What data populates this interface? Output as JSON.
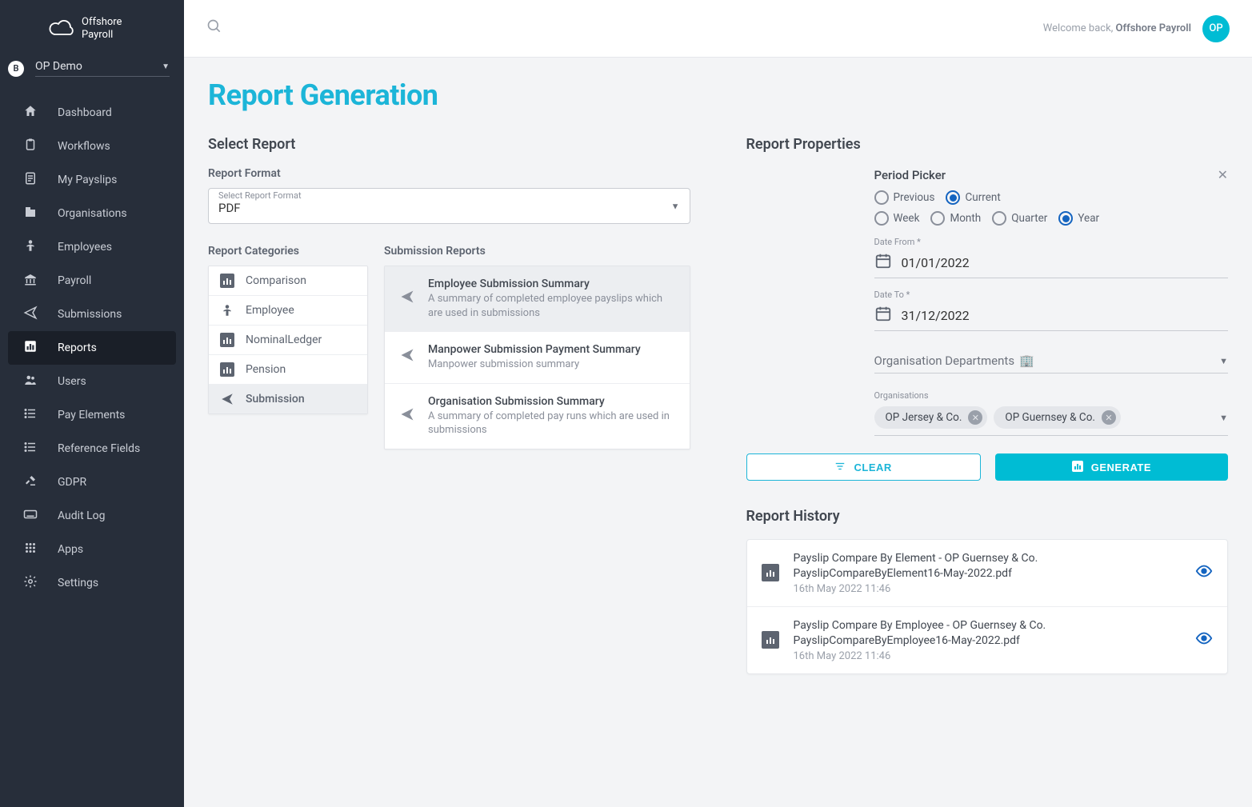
{
  "app": {
    "name1": "Offshore",
    "name2": "Payroll"
  },
  "org": {
    "bullet": "B",
    "name": "OP Demo"
  },
  "nav": [
    {
      "icon": "home",
      "label": "Dashboard"
    },
    {
      "icon": "clipboard",
      "label": "Workflows"
    },
    {
      "icon": "doc",
      "label": "My Payslips"
    },
    {
      "icon": "building",
      "label": "Organisations"
    },
    {
      "icon": "person",
      "label": "Employees"
    },
    {
      "icon": "bank",
      "label": "Payroll"
    },
    {
      "icon": "send",
      "label": "Submissions"
    },
    {
      "icon": "chart",
      "label": "Reports",
      "active": true
    },
    {
      "icon": "users",
      "label": "Users"
    },
    {
      "icon": "list",
      "label": "Pay Elements"
    },
    {
      "icon": "list",
      "label": "Reference Fields"
    },
    {
      "icon": "gavel",
      "label": "GDPR"
    },
    {
      "icon": "keyboard",
      "label": "Audit Log"
    },
    {
      "icon": "grid",
      "label": "Apps"
    },
    {
      "icon": "gear",
      "label": "Settings"
    }
  ],
  "topbar": {
    "welcome_prefix": "Welcome back, ",
    "welcome_name": "Offshore Payroll",
    "avatar": "OP"
  },
  "page": {
    "title": "Report Generation",
    "select_report": "Select Report",
    "report_format": "Report Format",
    "format_label": "Select Report Format",
    "format_value": "PDF",
    "categories_h": "Report Categories",
    "sub_reports_h": "Submission Reports"
  },
  "categories": [
    {
      "icon": "chart",
      "label": "Comparison"
    },
    {
      "icon": "person",
      "label": "Employee"
    },
    {
      "icon": "chart",
      "label": "NominalLedger"
    },
    {
      "icon": "chart",
      "label": "Pension"
    },
    {
      "icon": "send",
      "label": "Submission",
      "active": true
    }
  ],
  "reports": [
    {
      "title": "Employee Submission Summary",
      "desc": "A summary of completed employee payslips which are used in submissions",
      "active": true
    },
    {
      "title": "Manpower Submission Payment Summary",
      "desc": "Manpower submission summary"
    },
    {
      "title": "Organisation Submission Summary",
      "desc": "A summary of completed pay runs which are used in submissions"
    }
  ],
  "props": {
    "heading": "Report Properties",
    "period_title": "Period Picker",
    "rel": {
      "previous": "Previous",
      "current": "Current",
      "selected": "current"
    },
    "span": {
      "week": "Week",
      "month": "Month",
      "quarter": "Quarter",
      "year": "Year",
      "selected": "year"
    },
    "date_from_lbl": "Date From *",
    "date_from": "01/01/2022",
    "date_to_lbl": "Date To *",
    "date_to": "31/12/2022",
    "dept_label": "Organisation Departments",
    "orgs_label": "Organisations",
    "org_chips": [
      "OP Jersey & Co.",
      "OP Guernsey & Co."
    ],
    "clear": "CLEAR",
    "generate": "GENERATE"
  },
  "history": {
    "heading": "Report History",
    "items": [
      {
        "title": "Payslip Compare By Element - OP Guernsey & Co. PayslipCompareByElement16-May-2022.pdf",
        "date": "16th May 2022 11:46"
      },
      {
        "title": "Payslip Compare By Employee - OP Guernsey & Co. PayslipCompareByEmployee16-May-2022.pdf",
        "date": "16th May 2022 11:46"
      }
    ]
  }
}
